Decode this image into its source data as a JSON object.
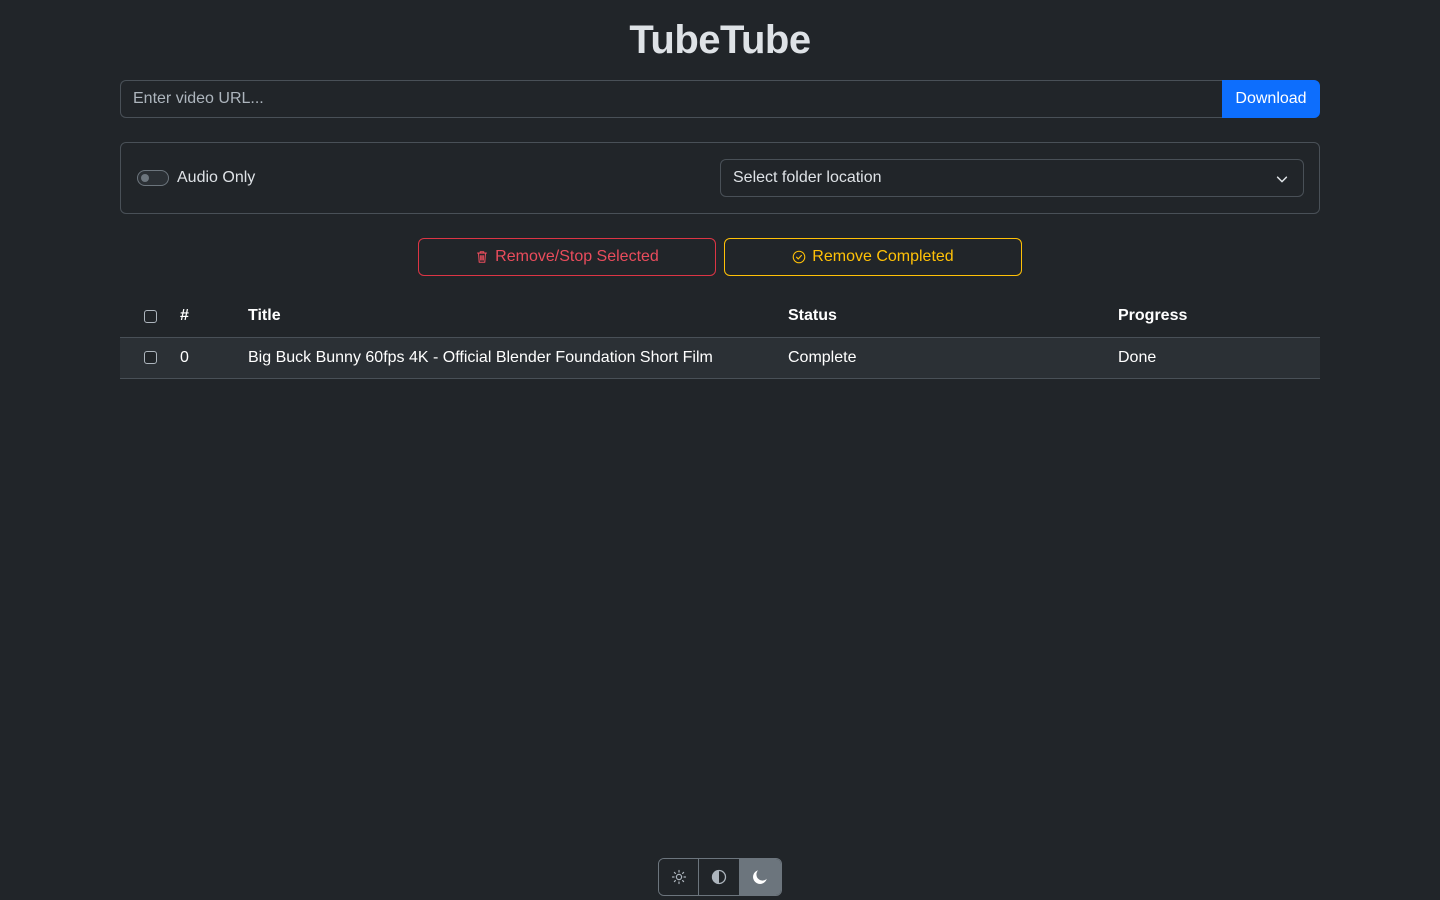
{
  "app": {
    "title": "TubeTube"
  },
  "url_bar": {
    "placeholder": "Enter video URL...",
    "value": "",
    "download_label": "Download"
  },
  "options": {
    "audio_only_label": "Audio Only",
    "audio_only_checked": false,
    "folder_select_value": "Select folder location"
  },
  "actions": {
    "remove_stop_label": "Remove/Stop Selected",
    "remove_completed_label": "Remove Completed"
  },
  "table": {
    "headers": {
      "num": "#",
      "title": "Title",
      "status": "Status",
      "progress": "Progress"
    },
    "rows": [
      {
        "num": "0",
        "title": "Big Buck Bunny 60fps 4K - Official Blender Foundation Short Film",
        "status": "Complete",
        "progress": "Done"
      }
    ]
  },
  "theme_switcher": {
    "options": [
      "sun-icon",
      "contrast-icon",
      "moon-icon"
    ],
    "active": "moon-icon"
  },
  "colors": {
    "background": "#212529",
    "primary": "#0d6efd",
    "danger": "#dc3545",
    "warning": "#ffc107"
  }
}
